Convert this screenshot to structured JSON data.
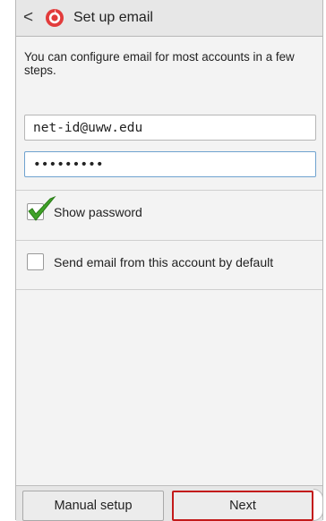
{
  "header": {
    "title": "Set up email",
    "back_glyph": "<",
    "icon": "email-app-icon"
  },
  "intro_text": "You can configure email for most accounts in a few steps.",
  "email": {
    "value": "net-id@uww.edu"
  },
  "password": {
    "value": "•••••••••"
  },
  "show_password": {
    "label": "Show password",
    "checked": true
  },
  "default_account": {
    "label": "Send email from this account by default",
    "checked": false
  },
  "buttons": {
    "manual": "Manual setup",
    "next": "Next"
  },
  "colors": {
    "highlight": "#c31a1a",
    "check_green": "#3fa227",
    "icon_red": "#e23b3b"
  }
}
